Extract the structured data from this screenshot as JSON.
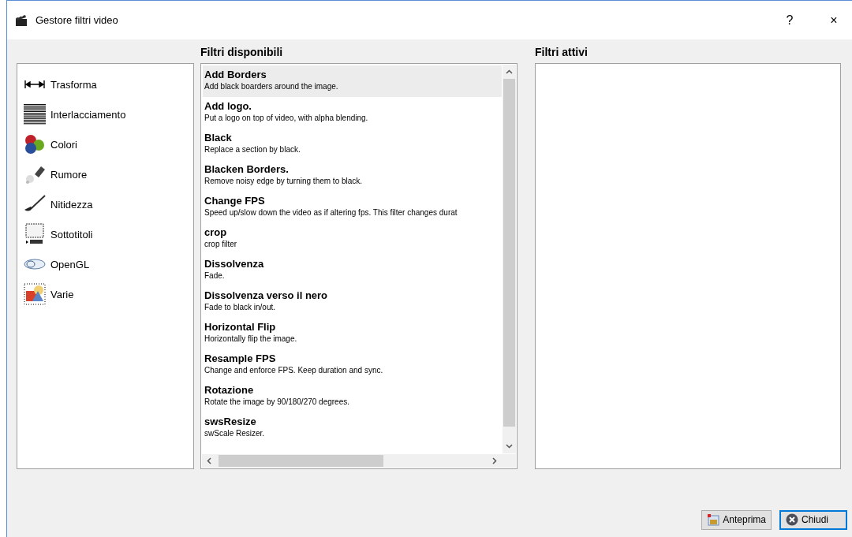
{
  "window": {
    "title": "Gestore filtri video",
    "help": "?",
    "close": "×"
  },
  "categories": [
    {
      "label": "Trasforma"
    },
    {
      "label": "Interlacciamento"
    },
    {
      "label": "Colori"
    },
    {
      "label": "Rumore"
    },
    {
      "label": "Nitidezza"
    },
    {
      "label": "Sottotitoli"
    },
    {
      "label": "OpenGL"
    },
    {
      "label": "Varie"
    }
  ],
  "available": {
    "heading": "Filtri disponibili",
    "filters": [
      {
        "name": "Add Borders",
        "description": "Add black boarders around the image.",
        "selected": true
      },
      {
        "name": "Add logo.",
        "description": "Put a logo on top of video, with alpha blending.",
        "selected": false
      },
      {
        "name": "Black",
        "description": "Replace a section by black.",
        "selected": false
      },
      {
        "name": "Blacken Borders.",
        "description": "Remove noisy edge by turning them to black.",
        "selected": false
      },
      {
        "name": "Change FPS",
        "description": "Speed up/slow down the video as if altering fps. This filter changes durat",
        "selected": false
      },
      {
        "name": "crop",
        "description": "crop filter",
        "selected": false
      },
      {
        "name": "Dissolvenza",
        "description": "Fade.",
        "selected": false
      },
      {
        "name": "Dissolvenza verso il nero",
        "description": "Fade to black in/out.",
        "selected": false
      },
      {
        "name": "Horizontal Flip",
        "description": "Horizontally flip the image.",
        "selected": false
      },
      {
        "name": "Resample FPS",
        "description": "Change and enforce FPS. Keep duration and sync.",
        "selected": false
      },
      {
        "name": "Rotazione",
        "description": "Rotate the image by 90/180/270 degrees.",
        "selected": false
      },
      {
        "name": "swsResize",
        "description": "swScale Resizer.",
        "selected": false
      }
    ]
  },
  "active": {
    "heading": "Filtri attivi"
  },
  "buttons": [
    {
      "label": "Anteprima",
      "kind": "preview",
      "focused": false
    },
    {
      "label": "Chiudi",
      "kind": "close",
      "focused": true
    }
  ]
}
